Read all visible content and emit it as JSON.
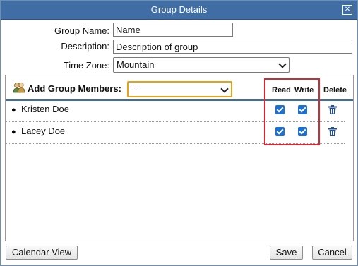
{
  "dialog": {
    "title": "Group Details"
  },
  "form": {
    "group_name_label": "Group Name:",
    "group_name_value": "Name",
    "description_label": "Description:",
    "description_value": "Description of group",
    "time_zone_label": "Time Zone:",
    "time_zone_value": "Mountain"
  },
  "members": {
    "add_label": "Add Group Members:",
    "add_select_value": "--",
    "col_read": "Read",
    "col_write": "Write",
    "col_delete": "Delete",
    "rows": [
      {
        "name": "Kristen Doe",
        "read": true,
        "write": true
      },
      {
        "name": "Lacey Doe",
        "read": true,
        "write": true
      }
    ]
  },
  "footer": {
    "calendar_view": "Calendar View",
    "save": "Save",
    "cancel": "Cancel"
  },
  "colors": {
    "titlebar": "#3f6da4",
    "checkbox": "#1f6fd0",
    "highlight": "#e0242f"
  }
}
